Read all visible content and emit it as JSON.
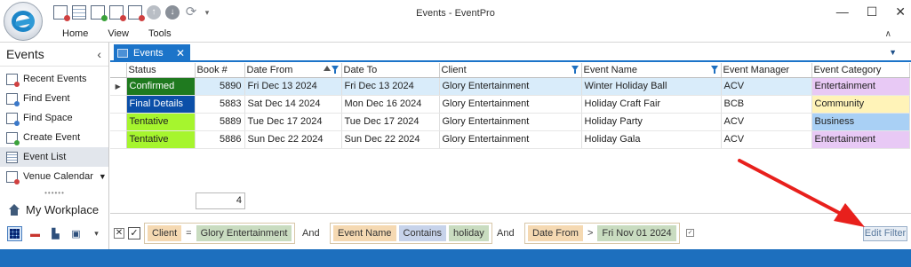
{
  "window": {
    "title": "Events - EventPro"
  },
  "ribbon": {
    "tabs": [
      "Home",
      "View",
      "Tools"
    ]
  },
  "nav": {
    "header": "Events",
    "items": [
      {
        "label": "Recent Events",
        "icon": "recent-events-icon"
      },
      {
        "label": "Find Event",
        "icon": "find-event-icon"
      },
      {
        "label": "Find Space",
        "icon": "find-space-icon"
      },
      {
        "label": "Create Event",
        "icon": "create-event-icon"
      },
      {
        "label": "Event List",
        "icon": "event-list-icon",
        "selected": true
      },
      {
        "label": "Venue Calendar",
        "icon": "venue-calendar-icon"
      }
    ],
    "workplace_label": "My Workplace"
  },
  "document_tab": {
    "label": "Events"
  },
  "grid": {
    "columns": [
      "Status",
      "Book #",
      "Date From",
      "Date To",
      "Client",
      "Event Name",
      "Event Manager",
      "Event Category"
    ],
    "rows": [
      {
        "status": "Confirmed",
        "status_color": "#1f7a1f",
        "status_text_color": "#ffffff",
        "book": "5890",
        "date_from": "Fri Dec 13 2024",
        "date_to": "Fri Dec 13 2024",
        "client": "Glory Entertainment",
        "event_name": "Winter Holiday Ball",
        "manager": "ACV",
        "category": "Entertainment",
        "category_color": "#e8c9f5",
        "selected": true
      },
      {
        "status": "Final Details",
        "status_color": "#0b4fa8",
        "status_text_color": "#ffffff",
        "book": "5883",
        "date_from": "Sat Dec 14 2024",
        "date_to": "Mon Dec 16 2024",
        "client": "Glory Entertainment",
        "event_name": "Holiday Craft Fair",
        "manager": "BCB",
        "category": "Community",
        "category_color": "#fff3b8",
        "selected": false
      },
      {
        "status": "Tentative",
        "status_color": "#a6f52e",
        "status_text_color": "#222222",
        "book": "5889",
        "date_from": "Tue Dec 17 2024",
        "date_to": "Tue Dec 17 2024",
        "client": "Glory Entertainment",
        "event_name": "Holiday Party",
        "manager": "ACV",
        "category": "Business",
        "category_color": "#a9d0f5",
        "selected": false
      },
      {
        "status": "Tentative",
        "status_color": "#a6f52e",
        "status_text_color": "#222222",
        "book": "5886",
        "date_from": "Sun Dec 22 2024",
        "date_to": "Sun Dec 22 2024",
        "client": "Glory Entertainment",
        "event_name": "Holiday Gala",
        "manager": "ACV",
        "category": "Entertainment",
        "category_color": "#e8c9f5",
        "selected": false
      }
    ],
    "row_count": "4"
  },
  "filter": {
    "groups": [
      {
        "field": "Client",
        "operator": "=",
        "value": "Glory Entertainment"
      },
      {
        "field": "Event Name",
        "operator": "Contains",
        "value": "holiday"
      },
      {
        "field": "Date From",
        "operator": ">",
        "value": "Fri Nov 01 2024"
      }
    ],
    "and_label": "And",
    "edit_button": "Edit Filter"
  },
  "colors": {
    "accent": "#1c74c9",
    "statusbar": "#1d6fbe",
    "annotation_arrow": "#e8201c"
  }
}
